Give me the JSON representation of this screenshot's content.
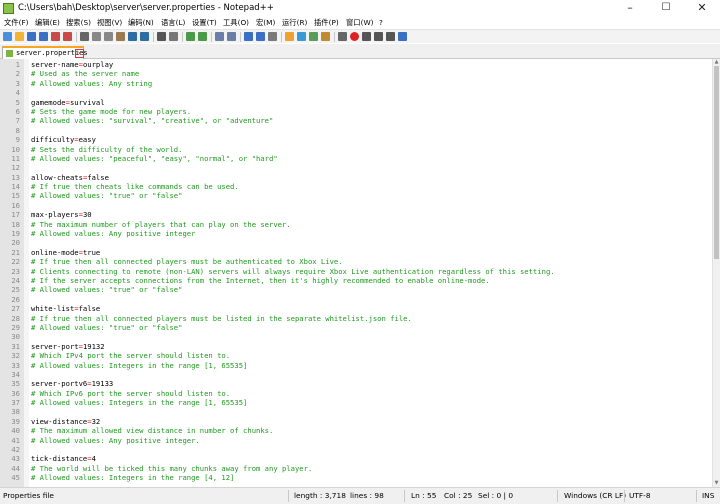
{
  "window": {
    "title": "C:\\Users\\bah\\Desktop\\server\\server.properties - Notepad++",
    "minimize": "–",
    "maximize": "☐",
    "close": "✕"
  },
  "menu": [
    "文件(F)",
    "编辑(E)",
    "搜索(S)",
    "视图(V)",
    "编码(N)",
    "语言(L)",
    "设置(T)",
    "工具(O)",
    "宏(M)",
    "运行(R)",
    "插件(P)",
    "窗口(W)",
    "?"
  ],
  "tab": {
    "label": "server.properties",
    "close": "x"
  },
  "editor": {
    "lines": [
      {
        "n": "1",
        "k": "server-name",
        "v": "ourplay"
      },
      {
        "n": "2",
        "c": "# Used as the server name"
      },
      {
        "n": "3",
        "c": "# Allowed values: Any string"
      },
      {
        "n": "4"
      },
      {
        "n": "5",
        "k": "gamemode",
        "v": "survival"
      },
      {
        "n": "6",
        "c": "# Sets the game mode for new players."
      },
      {
        "n": "7",
        "c": "# Allowed values: \"survival\", \"creative\", or \"adventure\""
      },
      {
        "n": "8"
      },
      {
        "n": "9",
        "k": "difficulty",
        "v": "easy"
      },
      {
        "n": "10",
        "c": "# Sets the difficulty of the world."
      },
      {
        "n": "11",
        "c": "# Allowed values: \"peaceful\", \"easy\", \"normal\", or \"hard\""
      },
      {
        "n": "12"
      },
      {
        "n": "13",
        "k": "allow-cheats",
        "v": "false"
      },
      {
        "n": "14",
        "c": "# If true then cheats like commands can be used."
      },
      {
        "n": "15",
        "c": "# Allowed values: \"true\" or \"false\""
      },
      {
        "n": "16"
      },
      {
        "n": "17",
        "k": "max-players",
        "v": "30"
      },
      {
        "n": "18",
        "c": "# The maximum number of players that can play on the server."
      },
      {
        "n": "19",
        "c": "# Allowed values: Any positive integer"
      },
      {
        "n": "20"
      },
      {
        "n": "21",
        "k": "online-mode",
        "v": "true"
      },
      {
        "n": "22",
        "c": "# If true then all connected players must be authenticated to Xbox Live."
      },
      {
        "n": "23",
        "c": "# Clients connecting to remote (non-LAN) servers will always require Xbox Live authentication regardless of this setting."
      },
      {
        "n": "24",
        "c": "# If the server accepts connections from the Internet, then it's highly recommended to enable online-mode."
      },
      {
        "n": "25",
        "c": "# Allowed values: \"true\" or \"false\""
      },
      {
        "n": "26"
      },
      {
        "n": "27",
        "k": "white-list",
        "v": "false"
      },
      {
        "n": "28",
        "c": "# If true then all connected players must be listed in the separate whitelist.json file."
      },
      {
        "n": "29",
        "c": "# Allowed values: \"true\" or \"false\""
      },
      {
        "n": "30"
      },
      {
        "n": "31",
        "k": "server-port",
        "v": "19132"
      },
      {
        "n": "32",
        "c": "# Which IPv4 port the server should listen to."
      },
      {
        "n": "33",
        "c": "# Allowed values: Integers in the range [1, 65535]"
      },
      {
        "n": "34"
      },
      {
        "n": "35",
        "k": "server-portv6",
        "v": "19133"
      },
      {
        "n": "36",
        "c": "# Which IPv6 port the server should listen to."
      },
      {
        "n": "37",
        "c": "# Allowed values: Integers in the range [1, 65535]"
      },
      {
        "n": "38"
      },
      {
        "n": "39",
        "k": "view-distance",
        "v": "32"
      },
      {
        "n": "40",
        "c": "# The maximum allowed view distance in number of chunks."
      },
      {
        "n": "41",
        "c": "# Allowed values: Any positive integer."
      },
      {
        "n": "42"
      },
      {
        "n": "43",
        "k": "tick-distance",
        "v": "4"
      },
      {
        "n": "44",
        "c": "# The world will be ticked this many chunks away from any player."
      },
      {
        "n": "45",
        "c": "# Allowed values: Integers in the range [4, 12]"
      }
    ]
  },
  "status": {
    "file_type": "Properties file",
    "length": "length : 3,718",
    "lines": "lines : 98",
    "ln": "Ln : 55",
    "col": "Col : 25",
    "sel": "Sel : 0 | 0",
    "eol": "Windows (CR LF)",
    "encoding": "UTF-8",
    "mode": "INS"
  },
  "icons": {
    "toolbar": [
      "new-file-icon",
      "open-file-icon",
      "save-icon",
      "save-all-icon",
      "close-icon",
      "close-all-icon",
      "print-icon",
      "cut-icon",
      "copy-icon",
      "paste-icon",
      "undo-icon",
      "redo-icon",
      "find-icon",
      "replace-icon",
      "zoom-in-icon",
      "zoom-out-icon",
      "sync-v-icon",
      "sync-h-icon",
      "word-wrap-icon",
      "show-all-chars-icon",
      "indent-guide-icon",
      "lang-udl-icon",
      "doc-map-icon",
      "function-list-icon",
      "folder-as-workspace-icon",
      "monitoring-icon",
      "record-macro-icon",
      "stop-record-icon",
      "play-macro-icon",
      "play-multi-icon",
      "save-macro-icon"
    ]
  }
}
